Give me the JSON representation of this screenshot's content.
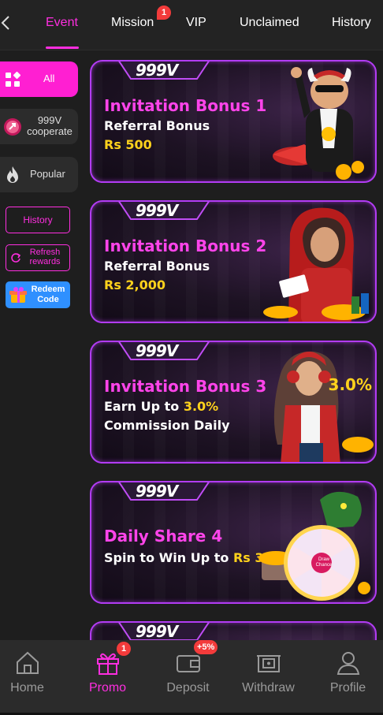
{
  "tabs": [
    {
      "label": "Event",
      "active": true
    },
    {
      "label": "Mission",
      "badge": "1"
    },
    {
      "label": "VIP"
    },
    {
      "label": "Unclaimed"
    },
    {
      "label": "History"
    }
  ],
  "sidebar": {
    "all_label": "All",
    "cooperate_label_1": "999V",
    "cooperate_label_2": "cooperate",
    "popular_label": "Popular",
    "history_label": "History",
    "refresh_label_1": "Refresh",
    "refresh_label_2": "rewards",
    "redeem_label_1": "Redeem",
    "redeem_label_2": "Code"
  },
  "logo_text": "999V",
  "banners": [
    {
      "title": "Invitation Bonus 1",
      "line1": "Referral Bonus",
      "line2_prefix": "",
      "line2_value": "Rs 500",
      "line3": ""
    },
    {
      "title": "Invitation Bonus 2",
      "line1": "Referral Bonus",
      "line2_prefix": "",
      "line2_value": "Rs 2,000",
      "line3": ""
    },
    {
      "title": "Invitation Bonus 3",
      "line1_prefix": "Earn Up to ",
      "line1_value": "3.0%",
      "line2": "Commission Daily",
      "art_text": "3.0%"
    },
    {
      "title": "Daily Share 4",
      "line1_prefix": "Spin to Win Up to ",
      "line1_value": "Rs 300",
      "wheel_center": "Draw Chance"
    }
  ],
  "bottom_nav": [
    {
      "label": "Home",
      "icon": "home-icon"
    },
    {
      "label": "Promo",
      "icon": "gift-icon",
      "badge": "1",
      "active": true
    },
    {
      "label": "Deposit",
      "icon": "wallet-icon",
      "badge": "+5%"
    },
    {
      "label": "Withdraw",
      "icon": "withdraw-icon"
    },
    {
      "label": "Profile",
      "icon": "profile-icon"
    }
  ],
  "colors": {
    "accent": "#ff2ee0",
    "gold": "#ffd21c",
    "badge": "#f33b3b",
    "redeem": "#2f90ff"
  }
}
